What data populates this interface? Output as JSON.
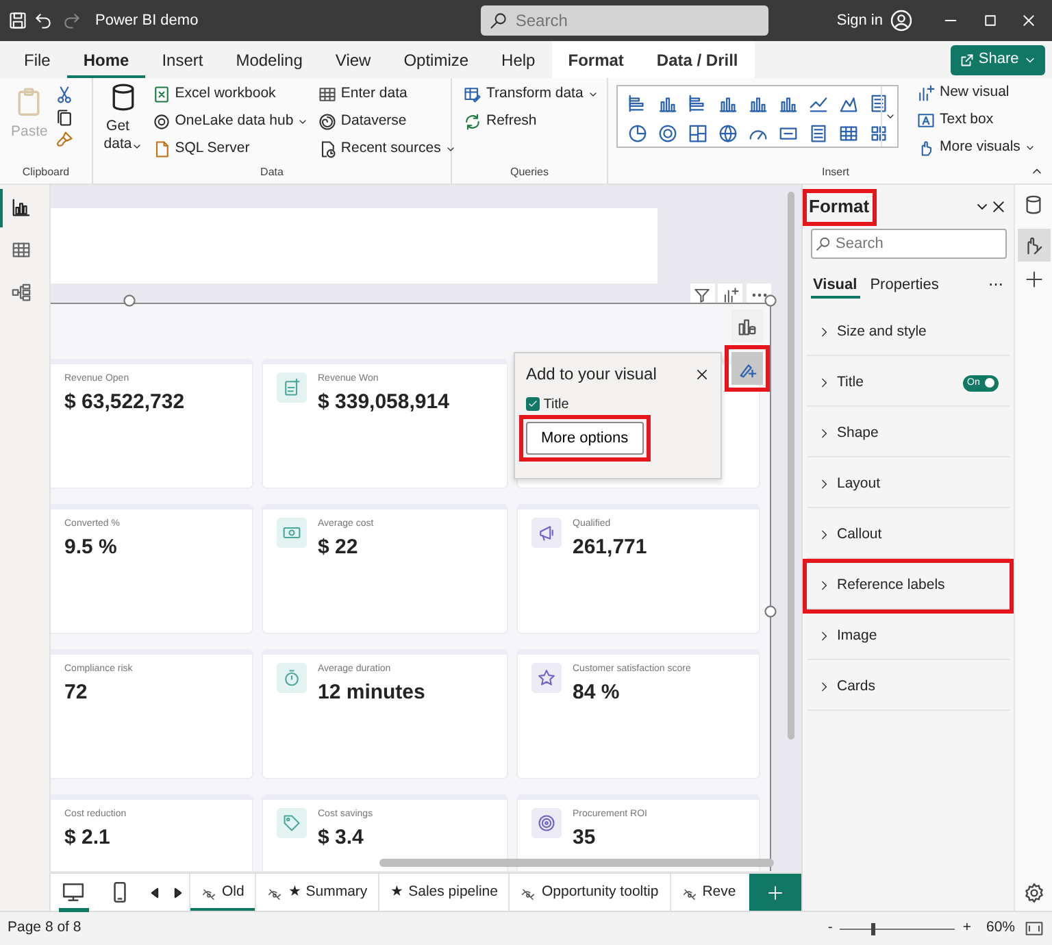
{
  "titlebar": {
    "title": "Power BI demo",
    "search": {
      "placeholder": "Search"
    },
    "sign_in": "Sign in"
  },
  "menu_tabs": [
    {
      "label": "File",
      "selected": false,
      "contextual": false
    },
    {
      "label": "Home",
      "selected": true,
      "contextual": false
    },
    {
      "label": "Insert",
      "selected": false,
      "contextual": false
    },
    {
      "label": "Modeling",
      "selected": false,
      "contextual": false
    },
    {
      "label": "View",
      "selected": false,
      "contextual": false
    },
    {
      "label": "Optimize",
      "selected": false,
      "contextual": false
    },
    {
      "label": "Help",
      "selected": false,
      "contextual": false
    },
    {
      "label": "Format",
      "selected": false,
      "contextual": true
    },
    {
      "label": "Data / Drill",
      "selected": false,
      "contextual": true
    }
  ],
  "share_button": "Share",
  "ribbon": {
    "clipboard": {
      "label": "Clipboard",
      "paste": {
        "label": "Paste",
        "disabled": true
      }
    },
    "data": {
      "label": "Data",
      "get_data": "Get data",
      "items": [
        {
          "label": "Excel workbook",
          "dropdown": false
        },
        {
          "label": "OneLake data hub",
          "dropdown": true
        },
        {
          "label": "SQL Server",
          "dropdown": false
        },
        {
          "label": "Enter data",
          "dropdown": false
        },
        {
          "label": "Dataverse",
          "dropdown": false
        },
        {
          "label": "Recent sources",
          "dropdown": true
        }
      ]
    },
    "queries": {
      "label": "Queries",
      "items": [
        {
          "label": "Transform data",
          "dropdown": true
        },
        {
          "label": "Refresh",
          "dropdown": false
        }
      ]
    },
    "insert": {
      "label": "Insert",
      "items": [
        {
          "label": "New visual",
          "dropdown": false
        },
        {
          "label": "Text box",
          "dropdown": false
        },
        {
          "label": "More visuals",
          "dropdown": true
        }
      ]
    }
  },
  "view_rail": [
    {
      "selected": true
    },
    {
      "selected": false
    },
    {
      "selected": false
    }
  ],
  "card_rows": [
    [
      {
        "label": "Revenue Open",
        "value": "$ 63,522,732"
      },
      {
        "label": "Revenue Won",
        "value": "$ 339,058,914"
      }
    ],
    [
      {
        "label": "Converted %",
        "value": "9.5 %"
      },
      {
        "label": "Average cost",
        "value": "$ 22"
      },
      {
        "label": "Qualified",
        "value": "261,771"
      }
    ],
    [
      {
        "label": "Compliance risk",
        "value": "72"
      },
      {
        "label": "Average duration",
        "value": "12 minutes"
      },
      {
        "label": "Customer satisfaction score",
        "value": "84 %"
      }
    ],
    [
      {
        "label": "Cost reduction",
        "value": "$ 2.1"
      },
      {
        "label": "Cost savings",
        "value": "$ 3.4"
      },
      {
        "label": "Procurement ROI",
        "value": "35"
      }
    ]
  ],
  "popup": {
    "title": "Add to your visual",
    "options": [
      {
        "label": "Title",
        "checked": true
      }
    ],
    "button": {
      "label": "More options",
      "highlighted": true
    }
  },
  "visual_side_buttons": [
    {
      "highlighted": false
    },
    {
      "highlighted": true
    }
  ],
  "layout_toggles": [
    {
      "selected": true
    },
    {
      "selected": false
    }
  ],
  "page_tabs": [
    {
      "label": "Old",
      "hidden": true,
      "selected": true
    },
    {
      "label": "★ Summary",
      "hidden": true,
      "selected": false
    },
    {
      "label": "★ Sales pipeline",
      "hidden": false,
      "selected": false
    },
    {
      "label": "Opportunity tooltip",
      "hidden": true,
      "selected": false
    },
    {
      "label": "Reve",
      "hidden": true,
      "selected": false
    }
  ],
  "format_pane": {
    "title": "Format",
    "highlighted": true,
    "search": {
      "placeholder": "Search"
    },
    "tabs": [
      {
        "label": "Visual",
        "selected": true
      },
      {
        "label": "Properties",
        "selected": false
      }
    ],
    "more": "⋯",
    "sections": [
      {
        "label": "Size and style",
        "highlighted": false
      },
      {
        "label": "Title",
        "highlighted": false,
        "toggle": {
          "on": true,
          "label": "On"
        }
      },
      {
        "label": "Shape",
        "highlighted": false
      },
      {
        "label": "Layout",
        "highlighted": false
      },
      {
        "label": "Callout",
        "highlighted": false
      },
      {
        "label": "Reference labels",
        "highlighted": true
      },
      {
        "label": "Image",
        "highlighted": false
      },
      {
        "label": "Cards",
        "highlighted": false
      }
    ]
  },
  "pane_rail": [
    {
      "selected": false
    },
    {
      "selected": true
    }
  ],
  "status_bar": {
    "page": "Page 8 of 8",
    "zoom": {
      "minus": "-",
      "plus": "+",
      "level": 0.28,
      "reading": "60%"
    }
  }
}
